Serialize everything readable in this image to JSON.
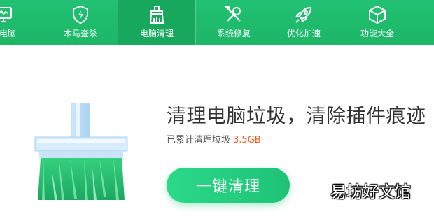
{
  "nav": {
    "items": [
      {
        "label": "的电脑",
        "icon": "monitor-icon"
      },
      {
        "label": "木马查杀",
        "icon": "shield-bolt-icon"
      },
      {
        "label": "电脑清理",
        "icon": "broom-icon",
        "active": true
      },
      {
        "label": "系统修复",
        "icon": "wrench-screwdriver-icon"
      },
      {
        "label": "优化加速",
        "icon": "rocket-icon"
      },
      {
        "label": "功能大全",
        "icon": "cube-icon"
      }
    ]
  },
  "main": {
    "headline": "清理电脑垃圾，清除插件痕迹",
    "sub_label": "已累计清理垃圾",
    "sub_value": "3.5GB",
    "button_label": "一键清理"
  },
  "watermark": "易坊好文馆",
  "colors": {
    "nav_bg": "#1db667",
    "nav_active": "#18a85d",
    "accent_value": "#ff5a1e",
    "button": "#21c97c"
  }
}
